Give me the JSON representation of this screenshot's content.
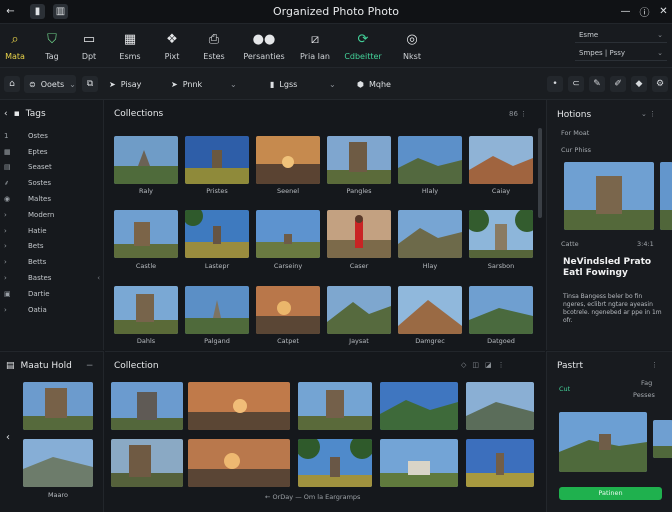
{
  "window": {
    "title": "Organized Photo Photo"
  },
  "ribbon": {
    "items": [
      {
        "label": "Mata",
        "icon": "search-icon"
      },
      {
        "label": "Tag",
        "icon": "shield-icon"
      },
      {
        "label": "Dpt",
        "icon": "monitor-icon"
      },
      {
        "label": "Esms",
        "icon": "grid-icon"
      },
      {
        "label": "Pixt",
        "icon": "gallery-icon"
      },
      {
        "label": "Estes",
        "icon": "print-icon"
      },
      {
        "label": "Persanties",
        "icon": "dots-icon"
      },
      {
        "label": "Pria Ian",
        "icon": "frame-icon"
      },
      {
        "label": "Cdbeitter",
        "icon": "share-icon"
      },
      {
        "label": "Nkst",
        "icon": "compass-icon"
      }
    ],
    "right_rows": [
      "Esme",
      "Smpes | Pssy"
    ]
  },
  "toolbar": {
    "sort_label": "Ooets",
    "play_label": "Pisay",
    "print_label": "Pnnk",
    "logs_label": "Lgss",
    "mqhe_label": "Mqhe"
  },
  "sidebar": {
    "title": "Tags",
    "items": [
      "Ostes",
      "Eptes",
      "Seaset",
      "Sostes",
      "Maltes",
      "Modern",
      "Hatie",
      "Bets",
      "Betts",
      "Bastes",
      "Dartie",
      "Oatia"
    ]
  },
  "collections": {
    "title": "Collections",
    "tools": "86 ⋮",
    "captions": [
      [
        "Raly",
        "Pristes",
        "Seenel",
        "Pangles",
        "Hlaly",
        "Caiay"
      ],
      [
        "Castle",
        "Lastepr",
        "Carseiny",
        "Caser",
        "Hlay",
        "Sarsbon"
      ],
      [
        "Dahls",
        "Palgand",
        "Catpet",
        "Jaysat",
        "Damgrec",
        "Datgoed"
      ]
    ]
  },
  "details": {
    "title": "Hotions",
    "label_1": "For Moat",
    "label_2": "Cur Phiss",
    "label_3": "Catte",
    "label_3_value": "3:4:1",
    "heading": "NeVindsled Prato Eatl Fowingy",
    "description": "Tinsa Bangess beler bo fin ngeres, eclibrt ngtare ayeasin bcotrele. ngenebed ar ppe in 1m ofr."
  },
  "lower_left": {
    "title": "Maatu Hold",
    "caption": "Maaro"
  },
  "lower_center": {
    "title": "Collection",
    "pager": "← OrDay — Om la Eargramps"
  },
  "lower_right": {
    "title": "Pastrt",
    "label_1": "Cut",
    "label_2": "Fag",
    "label_3": "Pesses",
    "button_label": "Patinen"
  },
  "colors": {
    "accent_yellow": "#e8d34a",
    "accent_green": "#1fb14e",
    "background": "#15181c"
  }
}
